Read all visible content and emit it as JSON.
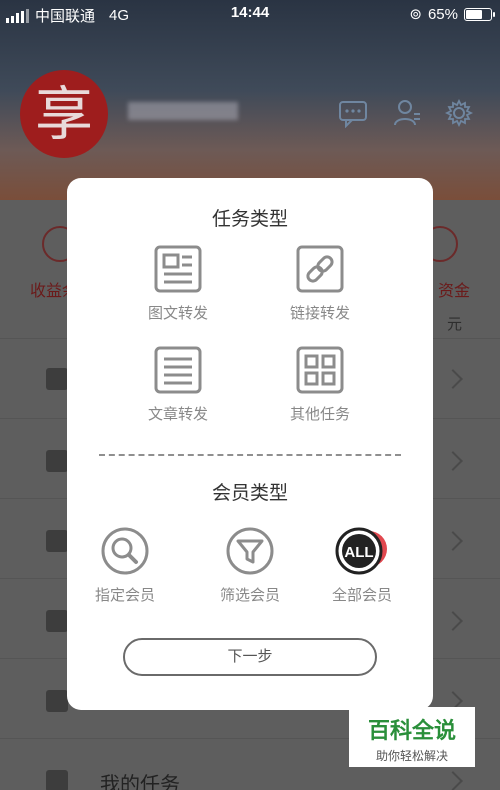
{
  "status_bar": {
    "carrier": "中国联通",
    "network": "4G",
    "time": "14:44",
    "battery": "65%",
    "battery_level": 0.65
  },
  "profile": {
    "avatar_char": "享"
  },
  "background": {
    "stat_left": "收益余",
    "stat_right": "资金",
    "unit": "元",
    "menu_item_my_tasks": "我的任务"
  },
  "modal": {
    "task_type_title": "任务类型",
    "task_options": [
      "图文转发",
      "链接转发",
      "文章转发",
      "其他任务"
    ],
    "member_type_title": "会员类型",
    "member_options": [
      "指定会员",
      "筛选会员",
      "全部会员"
    ],
    "next_button": "下一步"
  },
  "watermark": {
    "title": "百科全说",
    "subtitle": "助你轻松解决"
  },
  "colors": {
    "accent_red": "#e1484f",
    "icon_gray": "#8c8c8c",
    "overlay": "#6b6b6b"
  }
}
